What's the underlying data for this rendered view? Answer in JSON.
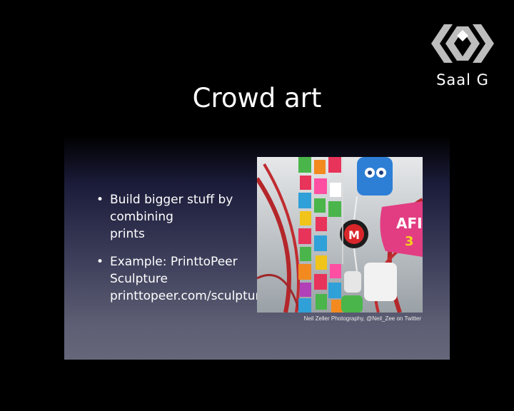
{
  "logo": {
    "text": "Saal G",
    "icon": "saal-logo-icon"
  },
  "slide": {
    "title": "Crowd art",
    "bullets": [
      {
        "lines": [
          "Build bigger stuff by combining",
          "prints"
        ]
      },
      {
        "lines": [
          "Example: PrinttoPeer Sculpture",
          "printtopeer.com/sculpture"
        ]
      }
    ],
    "photo": {
      "description_icon": "photo-sculpture-icon",
      "sign_text_1": "AFIN",
      "sign_text_2": "3",
      "logo_letter": "M"
    },
    "credit": "Neil Zeller Photography, @Neil_Zee on Twitter"
  },
  "colors": {
    "background": "#000000",
    "text": "#ffffff"
  }
}
